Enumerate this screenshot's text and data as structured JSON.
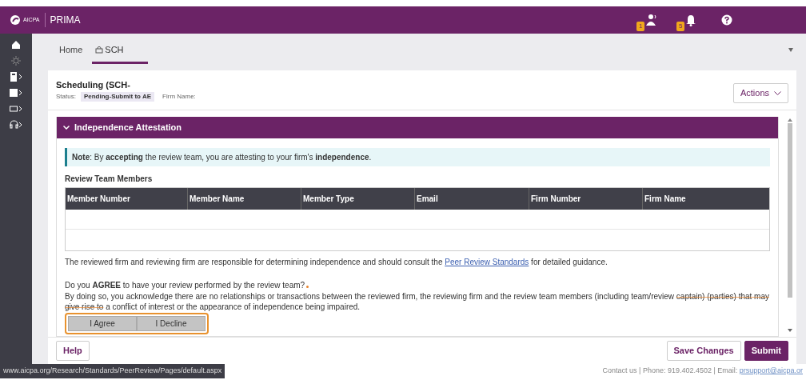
{
  "app_bar": {
    "logo_text": "AICPA",
    "title": "PRIMA",
    "notifications": [
      {
        "kind": "person",
        "badge": "1"
      },
      {
        "kind": "bell",
        "badge": "5"
      }
    ]
  },
  "tabs": [
    {
      "label": "Home",
      "kind": "plain",
      "selected": false
    },
    {
      "label": "SCH",
      "kind": "record",
      "selected": true
    }
  ],
  "record": {
    "title": "Scheduling (SCH-",
    "status_label": "Status:",
    "status": "Pending-Submit to AE",
    "firm_name_label": "Firm Name:",
    "actions_button": "Actions"
  },
  "section": {
    "title": "Independence Attestation",
    "expanded": true,
    "note": "**Note**: By **accepting** the review team, you are attesting to your firm's **independence**.",
    "table_title": "Review Team Members",
    "columns": [
      "Member Number",
      "Member Name",
      "Member Type",
      "Email",
      "Firm Number",
      "Firm Name"
    ],
    "guidance_before": "The reviewed firm and reviewing firm are responsible for determining independence and should consult the ",
    "guidance_link": "Peer Review Standards",
    "guidance_after": " for detailed guidance.",
    "question": "Do you **AGREE** to have your review performed by the review team?",
    "acknowledgement_before": "By doing so, you acknowledge there are no relationships or transactions between the reviewed firm, the reviewing firm and the review team members (including team/review ",
    "acknowledgement_struck": "captain) (parties) that may give rise to",
    "acknowledgement_after": " a conflict of interest or the appearance of independence being impaired.",
    "buttons": [
      "I Agree",
      "I Decline"
    ]
  },
  "footer_buttons": [
    {
      "label": "Help",
      "kind": "outline"
    },
    {
      "label": "Save Changes",
      "kind": "outline"
    },
    {
      "label": "Submit",
      "kind": "primary"
    }
  ],
  "status_url": "www.aicpa.org/Research/Standards/PeerReview/Pages/default.aspx",
  "contact": {
    "text": "Contact us | Phone: 919.402.4502 | Email: ",
    "email": "prsupport@aicpa.or"
  }
}
